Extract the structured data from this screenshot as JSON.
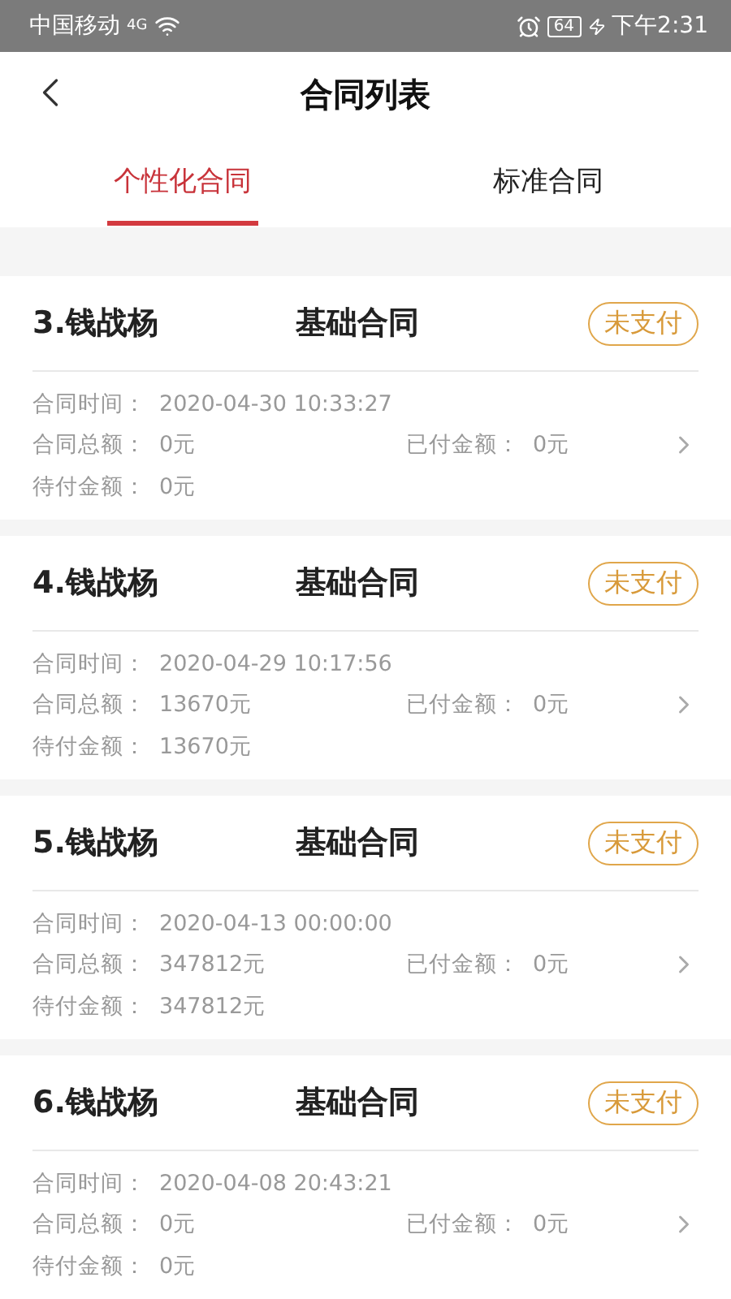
{
  "status_bar": {
    "carrier": "中国移动",
    "network": "4G",
    "battery": "64",
    "time": "下午2:31"
  },
  "header": {
    "title": "合同列表"
  },
  "tabs": [
    {
      "label": "个性化合同",
      "selected": true
    },
    {
      "label": "标准合同",
      "selected": false
    }
  ],
  "contracts": [
    {
      "name": "3.钱战杨",
      "type": "基础合同",
      "status": "未支付",
      "time_label": "合同时间：",
      "time": "2020-04-30 10:33:27",
      "total_label": "合同总额：",
      "total": "0元",
      "paid_label": "已付金额：",
      "paid": "0元",
      "due_label": "待付金额：",
      "due": "0元"
    },
    {
      "name": "4.钱战杨",
      "type": "基础合同",
      "status": "未支付",
      "time_label": "合同时间：",
      "time": "2020-04-29 10:17:56",
      "total_label": "合同总额：",
      "total": "13670元",
      "paid_label": "已付金额：",
      "paid": "0元",
      "due_label": "待付金额：",
      "due": "13670元"
    },
    {
      "name": "5.钱战杨",
      "type": "基础合同",
      "status": "未支付",
      "time_label": "合同时间：",
      "time": "2020-04-13 00:00:00",
      "total_label": "合同总额：",
      "total": "347812元",
      "paid_label": "已付金额：",
      "paid": "0元",
      "due_label": "待付金额：",
      "due": "347812元"
    },
    {
      "name": "6.钱战杨",
      "type": "基础合同",
      "status": "未支付",
      "time_label": "合同时间：",
      "time": "2020-04-08 20:43:21",
      "total_label": "合同总额：",
      "total": "0元",
      "paid_label": "已付金额：",
      "paid": "0元",
      "due_label": "待付金额：",
      "due": "0元"
    }
  ]
}
